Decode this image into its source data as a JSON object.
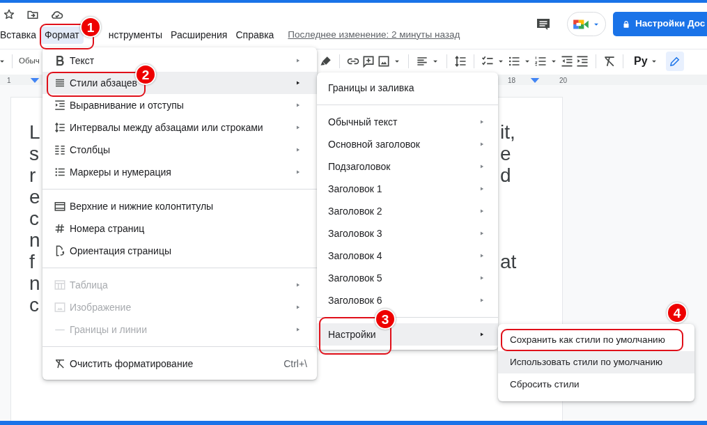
{
  "header": {
    "menu_bar": [
      {
        "label": "Вставка",
        "selected": false
      },
      {
        "label": "Формат",
        "selected": true
      },
      {
        "label": "нструменты",
        "selected": false
      },
      {
        "label": "Расширения",
        "selected": false
      },
      {
        "label": "Справка",
        "selected": false
      }
    ],
    "last_edit": "Последнее изменение: 2 минуты назад",
    "share_button": "Настройки Дос"
  },
  "toolbar": {
    "style_select": "Обыч",
    "input_tools": "Ру"
  },
  "ruler": {
    "labels": [
      "1",
      "18",
      "20"
    ]
  },
  "document": {
    "lines": [
      {
        "left": "L",
        "right": "it,"
      },
      {
        "left": "s",
        "right": "e"
      },
      {
        "left": "r",
        "right": "d"
      },
      {
        "left": "e"
      },
      {
        "left": "c"
      },
      {
        "left": "n"
      },
      {
        "left": "f",
        "right": "at"
      },
      {
        "left": "n"
      },
      {
        "left": "c"
      }
    ]
  },
  "format_menu": {
    "groups": [
      [
        {
          "label": "Текст",
          "has_submenu": true,
          "disabled": false,
          "selected": false
        },
        {
          "label": "Стили абзацев",
          "has_submenu": true,
          "disabled": false,
          "selected": true
        },
        {
          "label": "Выравнивание и отступы",
          "has_submenu": true,
          "disabled": false,
          "selected": false
        },
        {
          "label": "Интервалы между абзацами или строками",
          "has_submenu": true,
          "disabled": false,
          "selected": false
        },
        {
          "label": "Столбцы",
          "has_submenu": true,
          "disabled": false,
          "selected": false
        },
        {
          "label": "Маркеры и нумерация",
          "has_submenu": true,
          "disabled": false,
          "selected": false
        }
      ],
      [
        {
          "label": "Верхние и нижние колонтитулы",
          "has_submenu": false,
          "disabled": false,
          "selected": false
        },
        {
          "label": "Номера страниц",
          "has_submenu": false,
          "disabled": false,
          "selected": false
        },
        {
          "label": "Ориентация страницы",
          "has_submenu": false,
          "disabled": false,
          "selected": false
        }
      ],
      [
        {
          "label": "Таблица",
          "has_submenu": true,
          "disabled": true,
          "selected": false
        },
        {
          "label": "Изображение",
          "has_submenu": true,
          "disabled": true,
          "selected": false
        },
        {
          "label": "Границы и линии",
          "has_submenu": true,
          "disabled": true,
          "selected": false
        }
      ],
      [
        {
          "label": "Очистить форматирование",
          "has_submenu": false,
          "disabled": false,
          "selected": false,
          "shortcut": "Ctrl+\\"
        }
      ]
    ]
  },
  "paragraph_styles_menu": {
    "groups": [
      [
        {
          "label": "Границы и заливка",
          "has_submenu": false,
          "selected": false
        }
      ],
      [
        {
          "label": "Обычный текст",
          "has_submenu": true,
          "selected": false
        },
        {
          "label": "Основной заголовок",
          "has_submenu": true,
          "selected": false
        },
        {
          "label": "Подзаголовок",
          "has_submenu": true,
          "selected": false
        },
        {
          "label": "Заголовок 1",
          "has_submenu": true,
          "selected": false
        },
        {
          "label": "Заголовок 2",
          "has_submenu": true,
          "selected": false
        },
        {
          "label": "Заголовок 3",
          "has_submenu": true,
          "selected": false
        },
        {
          "label": "Заголовок 4",
          "has_submenu": true,
          "selected": false
        },
        {
          "label": "Заголовок 5",
          "has_submenu": true,
          "selected": false
        },
        {
          "label": "Заголовок 6",
          "has_submenu": true,
          "selected": false
        }
      ],
      [
        {
          "label": "Настройки",
          "has_submenu": true,
          "selected": true
        }
      ]
    ]
  },
  "settings_menu": {
    "items": [
      {
        "label": "Сохранить как стили по умолчанию",
        "selected": false
      },
      {
        "label": "Использовать стили по умолчанию",
        "selected": true
      },
      {
        "label": "Сбросить стили",
        "selected": false
      }
    ]
  },
  "annotations": [
    {
      "number": "1"
    },
    {
      "number": "2"
    },
    {
      "number": "3"
    },
    {
      "number": "4"
    }
  ]
}
